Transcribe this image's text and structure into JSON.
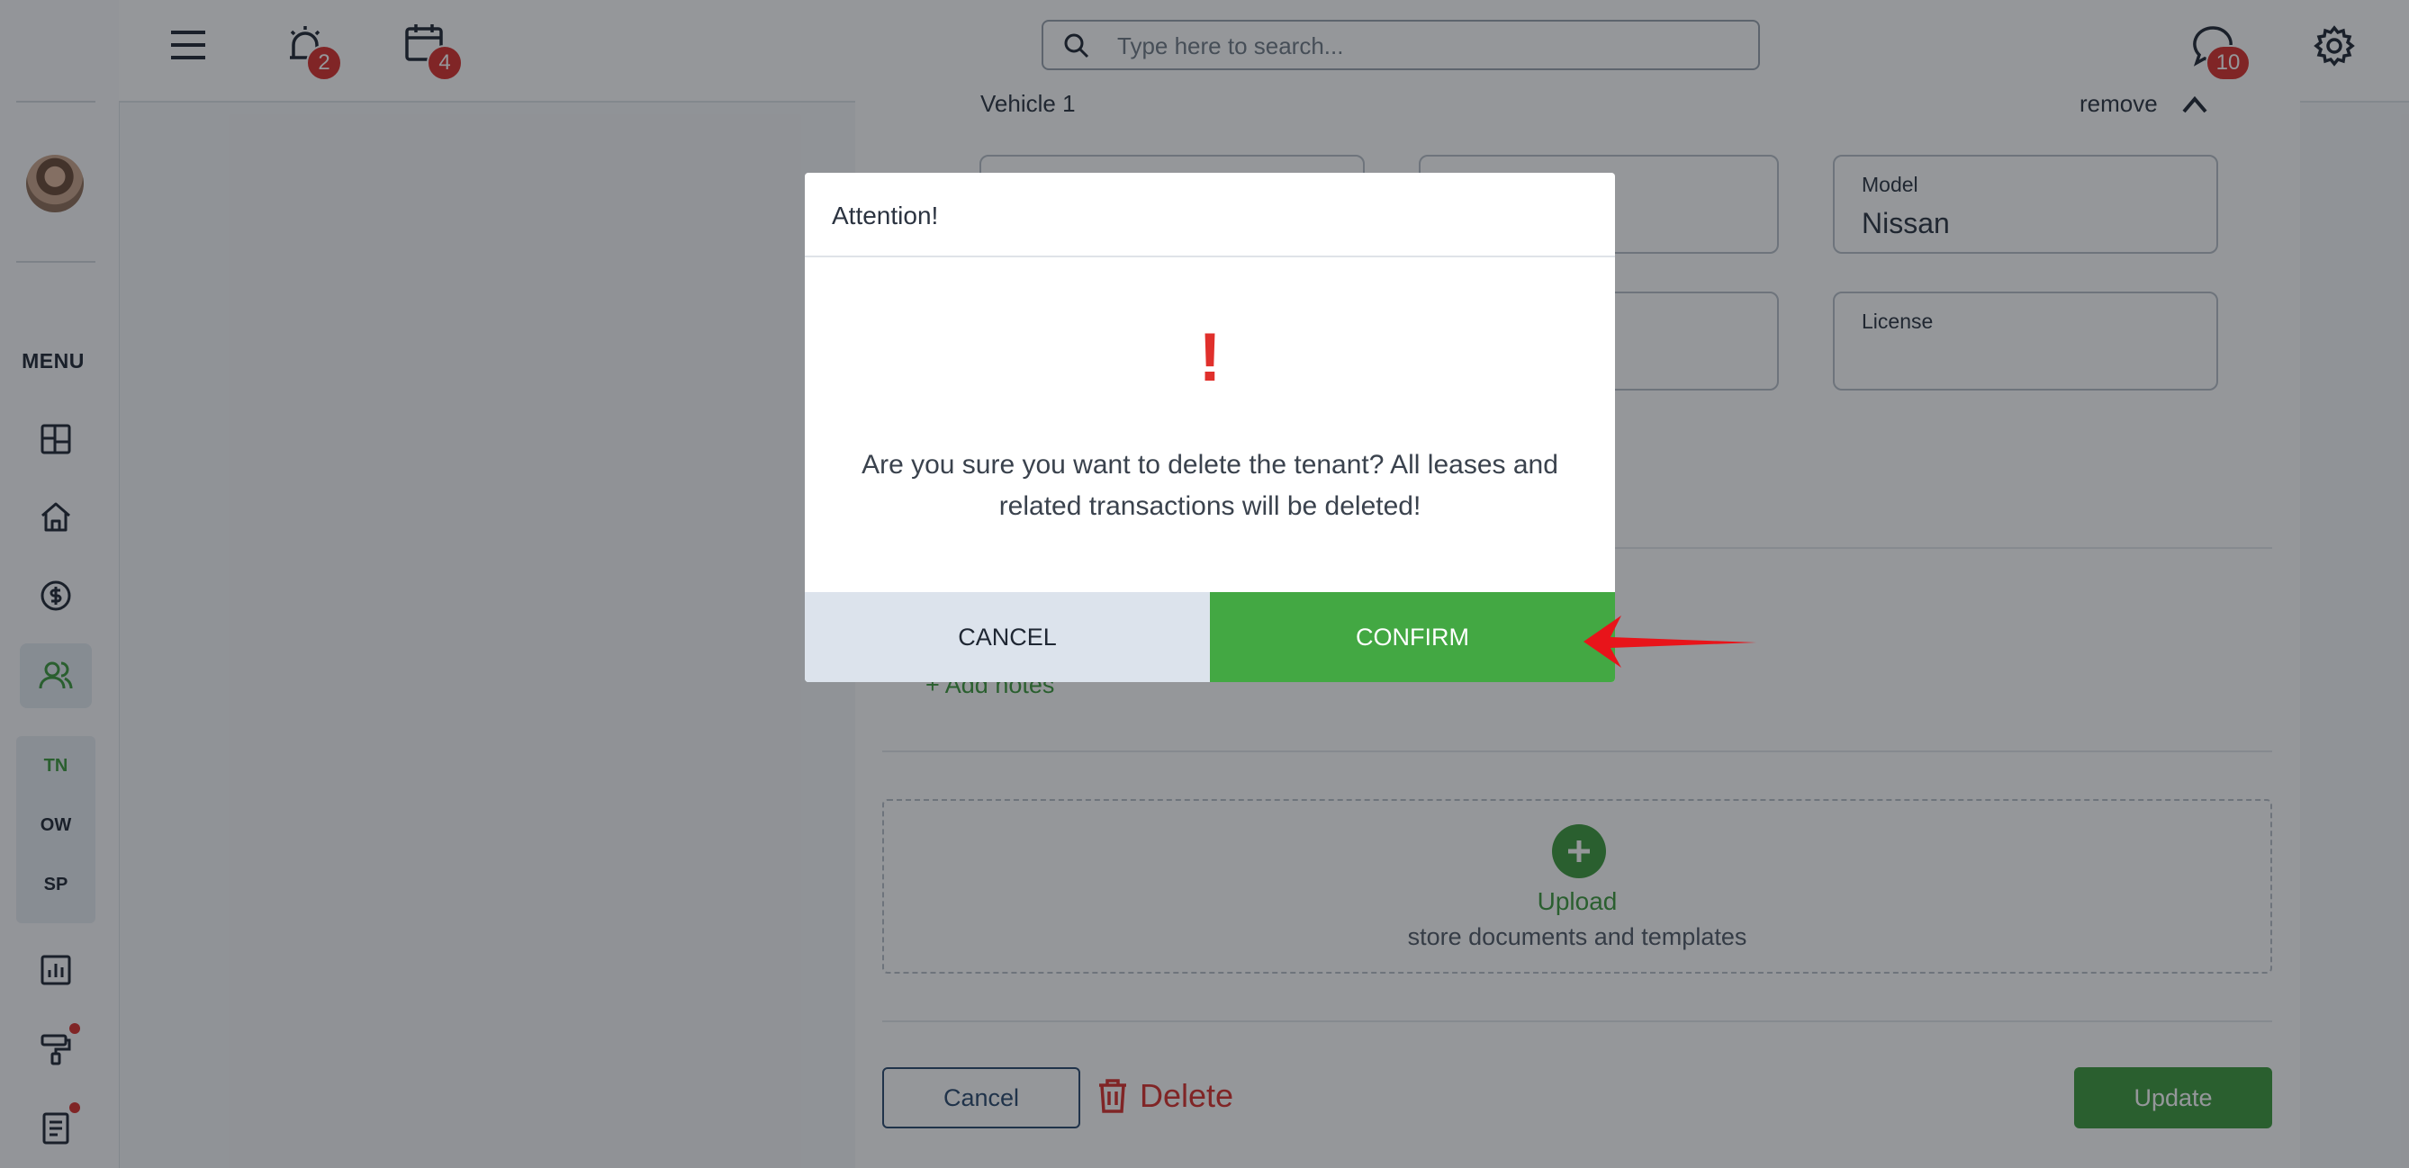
{
  "topbar": {
    "alarm_count": "2",
    "calendar_count": "4",
    "chat_count": "10",
    "search_placeholder": "Type here to search..."
  },
  "sidebar": {
    "menu_label": "MENU",
    "sub_items": [
      "TN",
      "OW",
      "SP"
    ]
  },
  "form": {
    "vehicle_title": "Vehicle 1",
    "remove_label": "remove",
    "model_label": "Model",
    "model_value": "Nissan",
    "license_label": "License",
    "license_value": "",
    "add_notes": "+ Add notes",
    "upload_title": "Upload",
    "upload_subtitle": "store documents and templates",
    "cancel_label": "Cancel",
    "delete_label": "Delete",
    "update_label": "Update"
  },
  "modal": {
    "title": "Attention!",
    "icon_symbol": "!",
    "message": "Are you sure you want to delete the tenant? All leases and related transactions will be deleted!",
    "cancel_label": "CANCEL",
    "confirm_label": "CONFIRM"
  },
  "colors": {
    "accent_green": "#43a843",
    "danger_red": "#d9302c",
    "annotation_arrow": "#e8141a"
  }
}
